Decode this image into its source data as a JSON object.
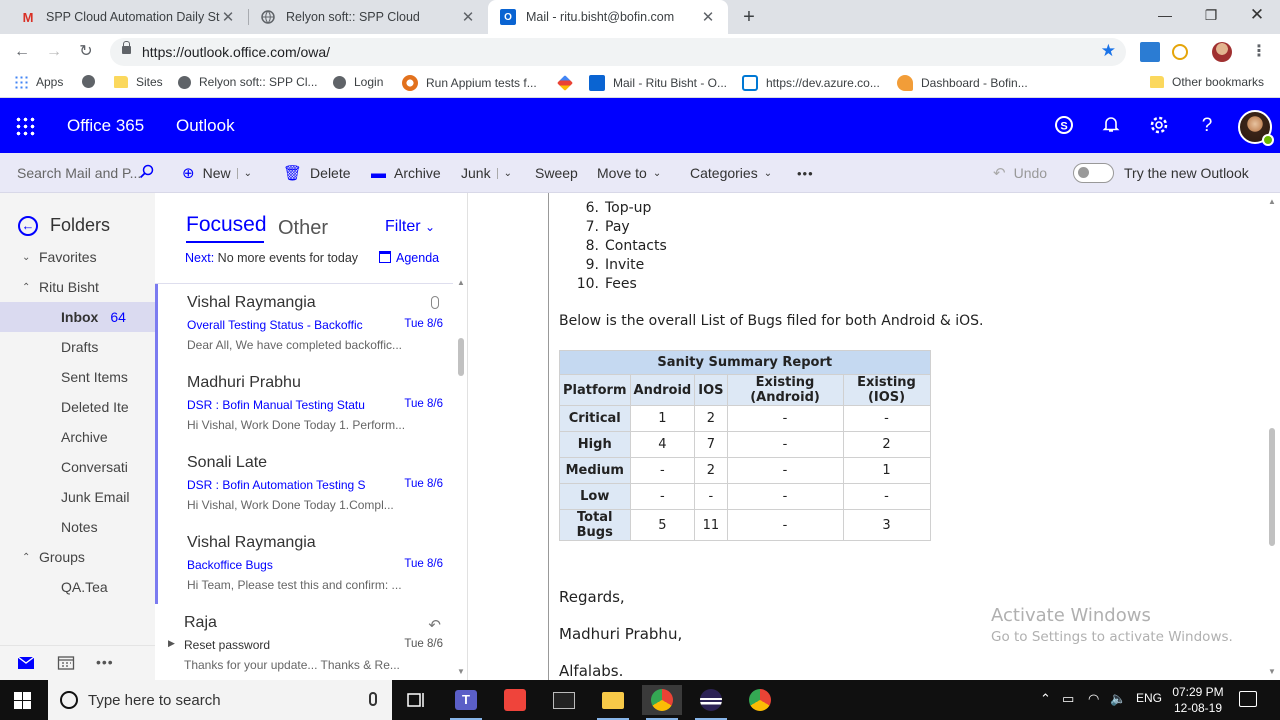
{
  "browser": {
    "tabs": [
      {
        "label": "SPP Cloud Automation Daily Stat",
        "icon": "gmail-icon"
      },
      {
        "label": "Relyon soft:: SPP Cloud",
        "icon": "globe-icon"
      },
      {
        "label": "Mail - ritu.bisht@bofin.com",
        "icon": "outlook-icon",
        "active": true
      }
    ],
    "url": "https://outlook.office.com/owa/",
    "bookmarks": [
      {
        "label": "Apps"
      },
      {
        "label": ""
      },
      {
        "label": "Sites"
      },
      {
        "label": "Relyon soft:: SPP Cl..."
      },
      {
        "label": "Login"
      },
      {
        "label": "Run Appium tests f..."
      },
      {
        "label": ""
      },
      {
        "label": "Mail - Ritu Bisht - O..."
      },
      {
        "label": "https://dev.azure.co..."
      },
      {
        "label": "Dashboard - Bofin..."
      },
      {
        "label": "Other bookmarks"
      }
    ]
  },
  "header": {
    "brand": "Office 365",
    "app": "Outlook",
    "accent": "#0000ff"
  },
  "commandbar": {
    "search_placeholder": "Search Mail and P...",
    "new": "New",
    "delete": "Delete",
    "archive": "Archive",
    "junk": "Junk",
    "sweep": "Sweep",
    "move_to": "Move to",
    "categories": "Categories",
    "more": "•••",
    "undo": "Undo",
    "try_new": "Try the new Outlook"
  },
  "folders": {
    "title": "Folders",
    "favorites": "Favorites",
    "account": "Ritu Bisht",
    "items": [
      {
        "label": "Inbox",
        "count": "64",
        "selected": true
      },
      {
        "label": "Drafts"
      },
      {
        "label": "Sent Items"
      },
      {
        "label": "Deleted Ite"
      },
      {
        "label": "Archive"
      },
      {
        "label": "Conversati"
      },
      {
        "label": "Junk Email"
      },
      {
        "label": "Notes"
      }
    ],
    "groups": "Groups",
    "group_items": [
      {
        "label": "QA.Tea"
      }
    ]
  },
  "list": {
    "tab_focused": "Focused",
    "tab_other": "Other",
    "filter": "Filter",
    "next_label": "Next:",
    "next_text": "No more events for today",
    "agenda": "Agenda",
    "messages": [
      {
        "from": "Vishal Raymangia",
        "subject": "Overall Testing Status - Backoffic",
        "date": "Tue 8/6",
        "preview": "Dear All,  We have completed backoffic...",
        "attachment": true,
        "unread": true
      },
      {
        "from": "Madhuri Prabhu",
        "subject": "DSR : Bofin Manual Testing Statu",
        "date": "Tue 8/6",
        "preview": "Hi Vishal,  Work Done Today 1. Perform...",
        "unread": true
      },
      {
        "from": "Sonali Late",
        "subject": "DSR : Bofin Automation Testing S",
        "date": "Tue 8/6",
        "preview": "Hi Vishal,     Work Done Today 1.Compl...",
        "unread": true
      },
      {
        "from": "Vishal Raymangia",
        "subject": "Backoffice Bugs",
        "date": "Tue 8/6",
        "preview": "Hi Team,  Please test this and confirm:  ...",
        "unread": true
      },
      {
        "from": "Raja",
        "subject": "Reset password",
        "date": "Tue 8/6",
        "preview": "Thanks for your update...  Thanks & Re...",
        "replied": true,
        "unread": false
      }
    ]
  },
  "reading": {
    "list_items": [
      {
        "n": "6.",
        "t": "Top-up"
      },
      {
        "n": "7.",
        "t": "Pay"
      },
      {
        "n": "8.",
        "t": "Contacts"
      },
      {
        "n": "9.",
        "t": "Invite"
      },
      {
        "n": "10.",
        "t": "Fees"
      }
    ],
    "intro": "Below is the overall List of Bugs filed for both Android & iOS.",
    "table": {
      "title": "Sanity Summary Report",
      "headers": [
        "Platform",
        "Android",
        "IOS",
        "Existing (Android)",
        "Existing (IOS)"
      ],
      "rows": [
        [
          "Critical",
          "1",
          "2",
          "-",
          "-"
        ],
        [
          "High",
          "4",
          "7",
          "-",
          "2"
        ],
        [
          "Medium",
          "-",
          "2",
          "-",
          "1"
        ],
        [
          "Low",
          "-",
          "-",
          "-",
          "-"
        ],
        [
          "Total Bugs",
          "5",
          "11",
          "-",
          "3"
        ]
      ]
    },
    "regards": "Regards,",
    "name": "Madhuri Prabhu,",
    "company": "Alfalabs."
  },
  "watermark": {
    "line1": "Activate Windows",
    "line2": "Go to Settings to activate Windows."
  },
  "taskbar": {
    "search": "Type here to search",
    "lang": "ENG",
    "time": "07:29 PM",
    "date": "12-08-19"
  }
}
